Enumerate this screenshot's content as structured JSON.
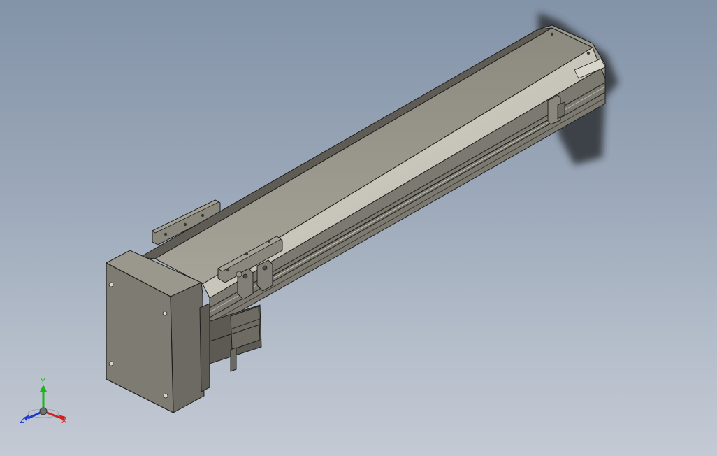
{
  "viewport": {
    "background_top": "#8393a8",
    "background_bottom": "#c4cad4"
  },
  "model": {
    "part_color": "#7f7d72",
    "part_top_color": "#8f8d82",
    "part_edge_color": "#1e1e1e",
    "shadow_color": "#333333"
  },
  "triad": {
    "y_label": "Y",
    "x_label": "X",
    "z_label": "Z",
    "x_color": "#d42020",
    "y_color": "#18b818",
    "z_color": "#1a38d8"
  }
}
